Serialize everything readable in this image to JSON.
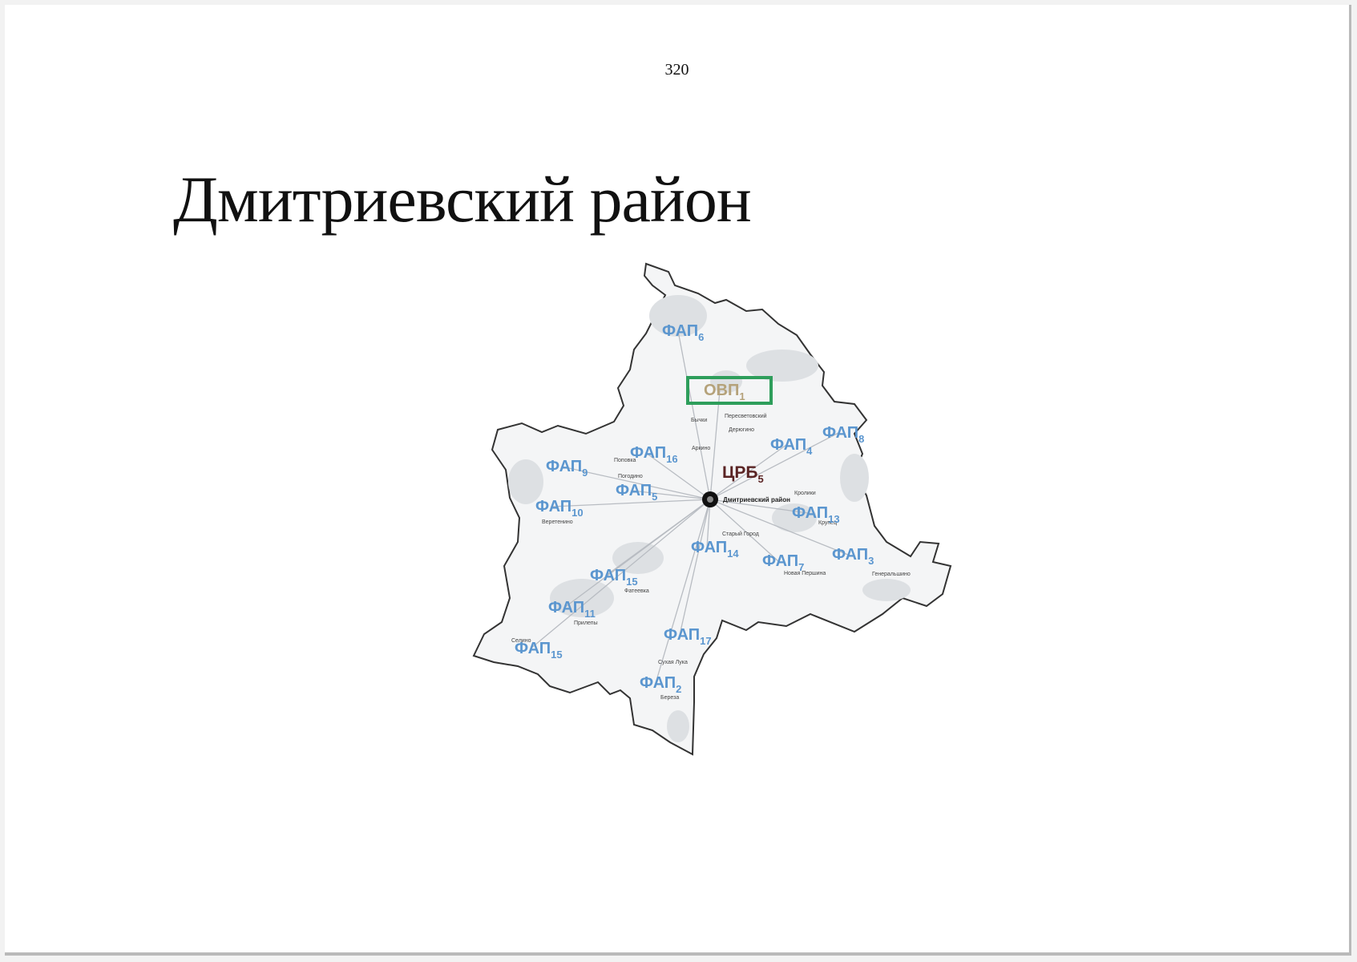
{
  "page_number": "320",
  "title": "Дмитриевский район",
  "map": {
    "center_marker_label": "Дмитриевский район",
    "colors": {
      "fap": "#5b96cf",
      "ovp": "#b5a27a",
      "ovp_box": "#2e9e5b",
      "crb": "#5a2424",
      "district_fill": "#f5f5f5",
      "district_border": "#333333"
    },
    "labels": [
      {
        "kind": "ovp",
        "base": "ОВП",
        "sub": "1"
      },
      {
        "kind": "crb",
        "base": "ЦРБ",
        "sub": "5"
      },
      {
        "kind": "fap",
        "base": "ФАП",
        "sub": "6"
      },
      {
        "kind": "fap",
        "base": "ФАП",
        "sub": "8"
      },
      {
        "kind": "fap",
        "base": "ФАП",
        "sub": "4"
      },
      {
        "kind": "fap",
        "base": "ФАП",
        "sub": "16"
      },
      {
        "kind": "fap",
        "base": "ФАП",
        "sub": "9"
      },
      {
        "kind": "fap",
        "base": "ФАП",
        "sub": "5"
      },
      {
        "kind": "fap",
        "base": "ФАП",
        "sub": "10"
      },
      {
        "kind": "fap",
        "base": "ФАП",
        "sub": "13"
      },
      {
        "kind": "fap",
        "base": "ФАП",
        "sub": "14"
      },
      {
        "kind": "fap",
        "base": "ФАП",
        "sub": "7"
      },
      {
        "kind": "fap",
        "base": "ФАП",
        "sub": "3"
      },
      {
        "kind": "fap",
        "base": "ФАП",
        "sub": "15"
      },
      {
        "kind": "fap",
        "base": "ФАП",
        "sub": "11"
      },
      {
        "kind": "fap",
        "base": "ФАП",
        "sub": "17"
      },
      {
        "kind": "fap",
        "base": "ФАП",
        "sub": "15"
      },
      {
        "kind": "fap",
        "base": "ФАП",
        "sub": "2"
      }
    ],
    "villages": [
      "Поповка",
      "Пересветовский",
      "Дерюгино",
      "Погодино",
      "Фатеевка",
      "Старый Город",
      "Новая Першина",
      "Генеральшино",
      "Крупец",
      "Веретенино",
      "Селино",
      "Прилепы",
      "Береза",
      "Аркино",
      "Бычки",
      "Кролики",
      "Сухая Лука"
    ]
  }
}
